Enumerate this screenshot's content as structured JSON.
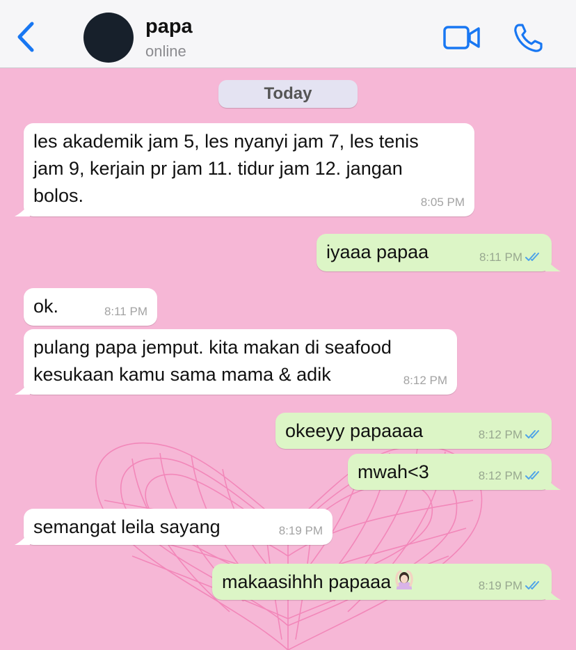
{
  "header": {
    "contact_name": "papa",
    "contact_status": "online",
    "back_icon": "chevron-left-icon",
    "video_icon": "video-camera-icon",
    "phone_icon": "phone-icon",
    "accent": "#1877f2"
  },
  "chat": {
    "date_label": "Today",
    "background_color": "#f6b7d6",
    "incoming_bubble_color": "#ffffff",
    "outgoing_bubble_color": "#dcf5c6",
    "messages": [
      {
        "direction": "in",
        "lines": [
          "les akademik jam 5, les nyanyi jam 7, les tenis",
          "jam 9, kerjain pr jam 11. tidur jam 12. jangan",
          "bolos."
        ],
        "time": "8:05 PM"
      },
      {
        "direction": "out",
        "lines": [
          "iyaaa papaa"
        ],
        "time": "8:11 PM"
      },
      {
        "direction": "in",
        "lines": [
          "ok."
        ],
        "time": "8:11 PM"
      },
      {
        "direction": "in",
        "lines": [
          "pulang papa jemput. kita makan di seafood",
          "kesukaan kamu sama mama & adik"
        ],
        "time": "8:12 PM"
      },
      {
        "direction": "out",
        "lines": [
          "okeeyy papaaaa"
        ],
        "time": "8:12 PM"
      },
      {
        "direction": "out",
        "lines": [
          "mwah<3"
        ],
        "time": "8:12 PM"
      },
      {
        "direction": "in",
        "lines": [
          "semangat leila sayang"
        ],
        "time": "8:19 PM"
      },
      {
        "direction": "out",
        "lines": [
          "makaasihhh papaaa"
        ],
        "time": "8:19 PM",
        "emoji": "person-arms-over-head-emoji"
      }
    ]
  }
}
